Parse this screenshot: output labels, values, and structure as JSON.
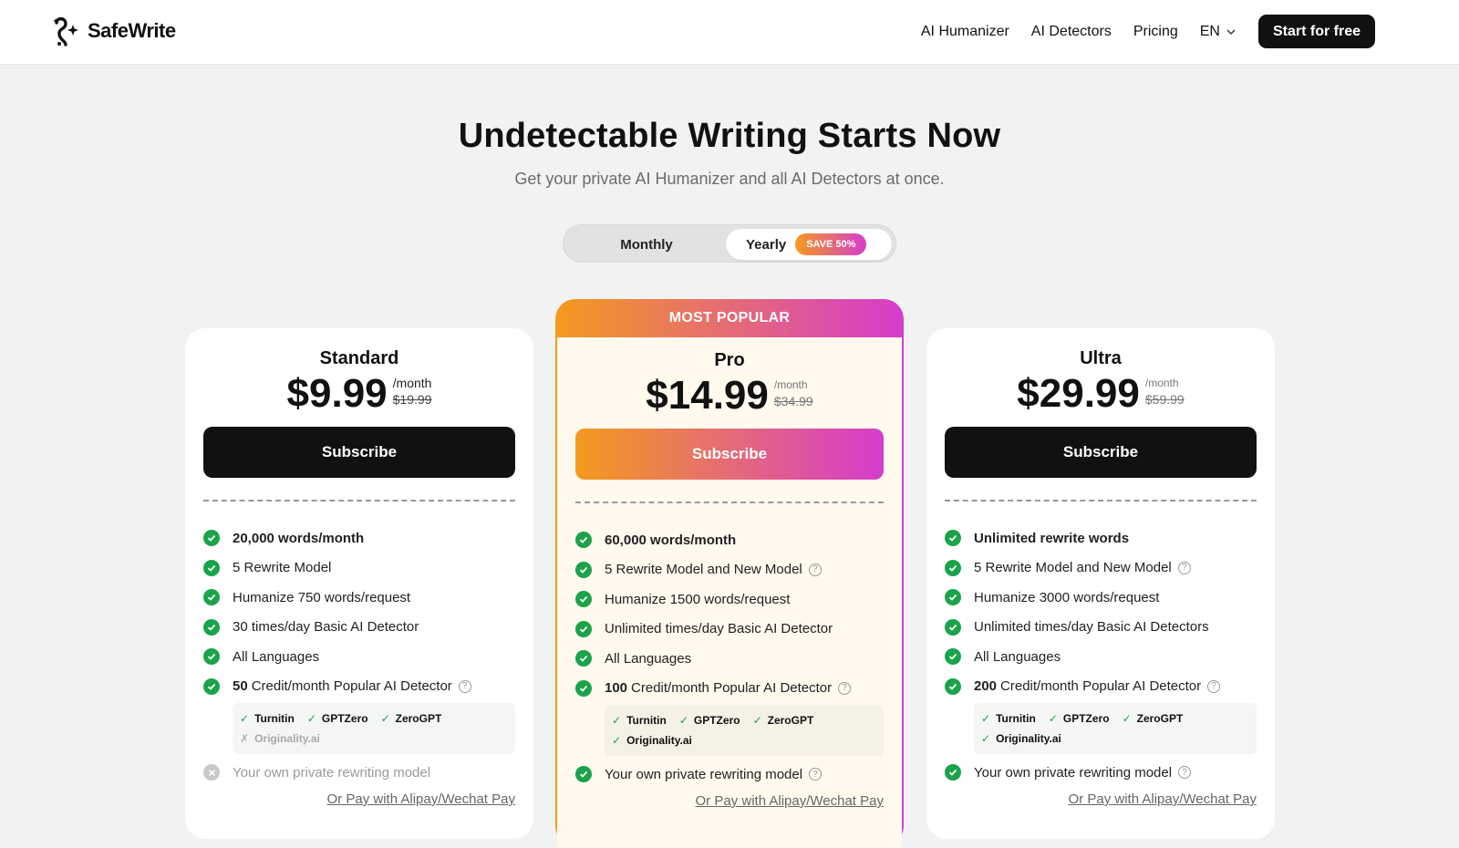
{
  "brand": {
    "name": "SafeWrite",
    "icon": "logo-swirl-sparkle"
  },
  "nav": {
    "links": [
      "AI Humanizer",
      "AI Detectors",
      "Pricing"
    ],
    "language": "EN",
    "cta": "Start for free"
  },
  "hero": {
    "title": "Undetectable Writing Starts Now",
    "subtitle": "Get your private AI Humanizer and all AI Detectors at once."
  },
  "billing": {
    "monthly": "Monthly",
    "yearly": "Yearly",
    "badge": "SAVE 50%",
    "selected": "Yearly"
  },
  "colors": {
    "accent_start": "#f49a1e",
    "accent_end": "#d53ccd",
    "check": "#1aa34a",
    "dark": "#111111"
  },
  "plans": [
    {
      "name": "Standard",
      "price": "$9.99",
      "per": "/month",
      "old_price": "$19.99",
      "subscribe": "Subscribe",
      "features": [
        {
          "bold": "20,000 words/month",
          "text": ""
        },
        {
          "bold": "",
          "text": "5 Rewrite Model"
        },
        {
          "bold": "",
          "text": "Humanize 750 words/request"
        },
        {
          "bold": "",
          "text": "30 times/day Basic AI Detector"
        },
        {
          "bold": "",
          "text": "All Languages"
        },
        {
          "bold": "50",
          "text": "Credit/month Popular AI Detector"
        }
      ],
      "detectors": [
        {
          "name": "Turnitin",
          "mark": "✓"
        },
        {
          "name": "GPTZero",
          "mark": "✓"
        },
        {
          "name": "ZeroGPT",
          "mark": "✓"
        },
        {
          "name": "Originality.ai",
          "mark": "✗"
        }
      ],
      "private_model": "Your own private rewriting model",
      "alt_pay": "Or Pay with Alipay/Wechat Pay"
    },
    {
      "banner": "MOST POPULAR",
      "name": "Pro",
      "price": "$14.99",
      "per": "/month",
      "old_price": "$34.99",
      "subscribe": "Subscribe",
      "features": [
        {
          "bold": "60,000 words/month",
          "text": ""
        },
        {
          "bold": "",
          "text": "5 Rewrite Model and New Model"
        },
        {
          "bold": "",
          "text": "Humanize 1500 words/request"
        },
        {
          "bold": "",
          "text": "Unlimited times/day Basic AI Detector"
        },
        {
          "bold": "",
          "text": "All Languages"
        },
        {
          "bold": "100",
          "text": "Credit/month Popular AI Detector"
        }
      ],
      "detectors": [
        {
          "name": "Turnitin",
          "mark": "✓"
        },
        {
          "name": "GPTZero",
          "mark": "✓"
        },
        {
          "name": "ZeroGPT",
          "mark": "✓"
        },
        {
          "name": "Originality.ai",
          "mark": "✓"
        }
      ],
      "private_model": "Your own private rewriting model",
      "alt_pay": "Or Pay with Alipay/Wechat Pay"
    },
    {
      "name": "Ultra",
      "price": "$29.99",
      "per": "/month",
      "old_price": "$59.99",
      "subscribe": "Subscribe",
      "features": [
        {
          "bold": "Unlimited rewrite words",
          "text": ""
        },
        {
          "bold": "",
          "text": "5 Rewrite Model and New Model"
        },
        {
          "bold": "",
          "text": "Humanize 3000 words/request"
        },
        {
          "bold": "",
          "text": "Unlimited times/day Basic AI Detectors"
        },
        {
          "bold": "",
          "text": "All Languages"
        },
        {
          "bold": "200",
          "text": "Credit/month Popular AI Detector"
        }
      ],
      "detectors": [
        {
          "name": "Turnitin",
          "mark": "✓"
        },
        {
          "name": "GPTZero",
          "mark": "✓"
        },
        {
          "name": "ZeroGPT",
          "mark": "✓"
        },
        {
          "name": "Originality.ai",
          "mark": "✓"
        }
      ],
      "private_model": "Your own private rewriting model",
      "alt_pay": "Or Pay with Alipay/Wechat Pay"
    }
  ]
}
